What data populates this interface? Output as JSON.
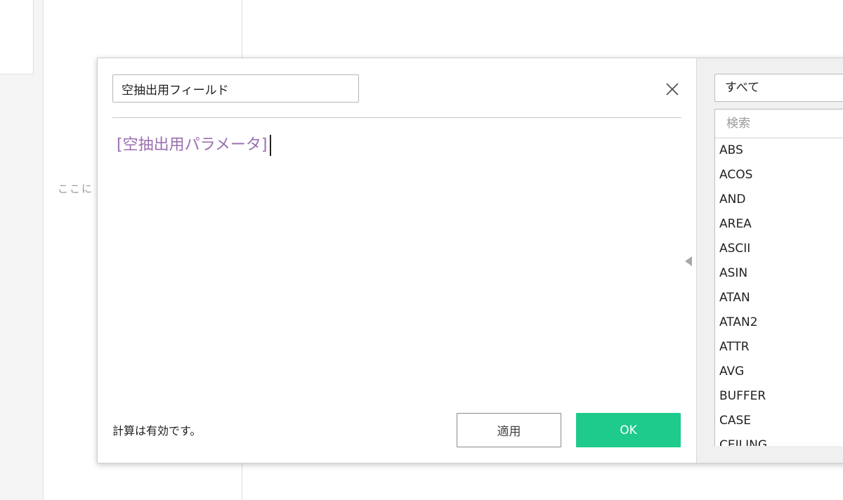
{
  "background": {
    "hint_text": "ここに"
  },
  "dialog": {
    "name_field_value": "空抽出用フィールド",
    "formula_text": "[空抽出用パラメータ]",
    "status_text": "計算は有効です。",
    "apply_label": "適用",
    "ok_label": "OK",
    "close_icon": "close-icon",
    "collapse_icon": "triangle-left-icon"
  },
  "functions": {
    "category_selected": "すべて",
    "search_placeholder": "検索",
    "items": [
      {
        "label": "ABS"
      },
      {
        "label": "ACOS"
      },
      {
        "label": "AND"
      },
      {
        "label": "AREA"
      },
      {
        "label": "ASCII"
      },
      {
        "label": "ASIN"
      },
      {
        "label": "ATAN"
      },
      {
        "label": "ATAN2"
      },
      {
        "label": "ATTR"
      },
      {
        "label": "AVG"
      },
      {
        "label": "BUFFER"
      },
      {
        "label": "CASE"
      },
      {
        "label": "CEILING"
      }
    ]
  },
  "colors": {
    "ok_button": "#1ecb8c",
    "formula_field": "#9a6fb0"
  }
}
